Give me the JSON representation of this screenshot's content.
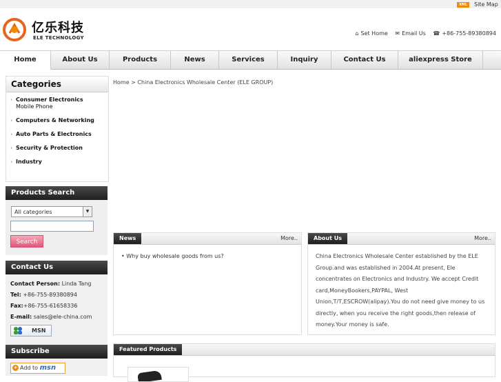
{
  "topbar": {
    "xml_badge": "XML",
    "sitemap": "Site Map"
  },
  "header": {
    "logo_cn": "亿乐科技",
    "logo_en": "ELE TECHNOLOGY",
    "set_home": "Set Home",
    "email_us": "Email Us",
    "phone": "+86-755-89380894"
  },
  "nav": {
    "items": [
      "Home",
      "About Us",
      "Products",
      "News",
      "Services",
      "Inquiry",
      "Contact Us",
      "aliexpress Store"
    ],
    "active": "Home"
  },
  "categories": {
    "title": "Categories",
    "items": [
      {
        "label": "Consumer Electronics",
        "sub": "Mobile Phone"
      },
      {
        "label": "Computers & Networking"
      },
      {
        "label": "Auto Parts & Electronics"
      },
      {
        "label": "Security & Protection"
      },
      {
        "label": "Industry"
      }
    ]
  },
  "products_search": {
    "title": "Products Search",
    "select_value": "All categories",
    "button": "Search"
  },
  "contact": {
    "title": "Contact Us",
    "person_label": "Contact Person:",
    "person": "Linda Tang",
    "tel_label": "Tel:",
    "tel": "+86-755-89380894",
    "fax_label": "Fax:",
    "fax": "+86-755-61658336",
    "email_label": "E-mail:",
    "email": "sales@ele-china.com",
    "msn": "MSN"
  },
  "subscribe": {
    "title": "Subscribe",
    "add_to": "Add to",
    "msn": "msn"
  },
  "breadcrumb": "Home > China Electronics Wholesale Center (ELE GROUP)",
  "news": {
    "tab": "News",
    "more": "More..",
    "items": [
      "Why buy wholesale goods from us?"
    ]
  },
  "about": {
    "tab": "About Us",
    "more": "More..",
    "text": "China Electronics Wholesale Center established by the ELE Group.and was established in 2004.At present, Ele concentrates on Electronics and Industry. We accept Credit card,MoneyBookers,PAYPAL, West Union,T/T,ESCROW(alipay).You do not need give money to us directly, when you receive the right goods,then release of money.Your money is safe."
  },
  "featured": {
    "tab": "Featured Products"
  }
}
